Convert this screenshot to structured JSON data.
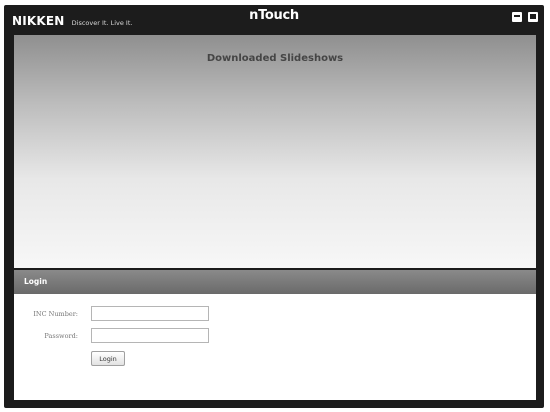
{
  "header": {
    "brand": "NIKKEN",
    "tagline": "Discover It. Live It.",
    "app_name": "nTouch",
    "minimize_icon": "minimize-icon",
    "maximize_icon": "maximize-icon"
  },
  "main": {
    "title": "Downloaded Slideshows"
  },
  "login": {
    "title": "Login",
    "inc_label": "INC Number:",
    "inc_value": "",
    "password_label": "Password:",
    "password_value": "",
    "button_label": "Login"
  },
  "colors": {
    "window_frame": "#1c1c1c",
    "login_header": "#7a7a7a",
    "text_dark": "#454545"
  }
}
